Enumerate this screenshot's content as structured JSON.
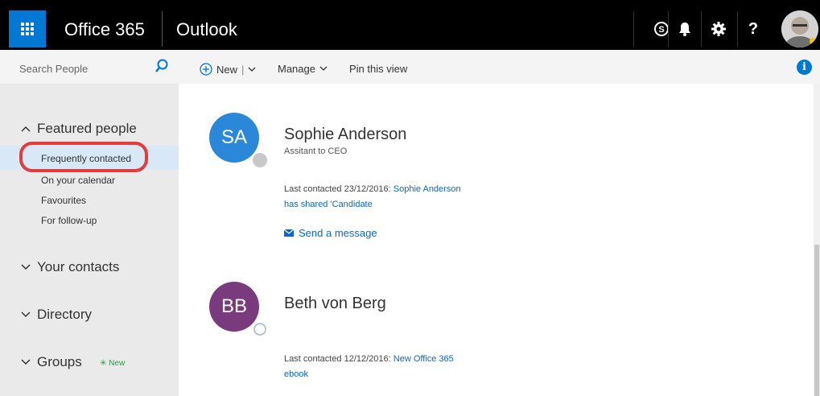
{
  "topbar": {
    "brand": "Office 365",
    "app": "Outlook",
    "icons": [
      "waffle-icon",
      "skype-icon",
      "bell-icon",
      "gear-icon",
      "help-icon"
    ],
    "help_label": "?"
  },
  "search": {
    "placeholder": "Search People"
  },
  "commandbar": {
    "new_label": "New",
    "new_sep": "|",
    "manage_label": "Manage",
    "pin_label": "Pin this view"
  },
  "nav": {
    "featured": {
      "label": "Featured people",
      "items": [
        "Frequently contacted",
        "On your calendar",
        "Favourites",
        "For follow-up"
      ]
    },
    "contacts": "Your contacts",
    "directory": "Directory",
    "groups": "Groups",
    "groups_badge": "New"
  },
  "people": [
    {
      "initials": "SA",
      "name": "Sophie Anderson",
      "title": "Assitant to CEO",
      "last_prefix": "Last contacted 23/12/2016: ",
      "last_link": "Sophie Anderson has shared 'Candidate",
      "send": "Send a message",
      "color": "#2b88d8"
    },
    {
      "initials": "BB",
      "name": "Beth von Berg",
      "last_prefix": "Last contacted 12/12/2016: ",
      "last_link": "New Office 365 ebook",
      "color": "#7a3a7e"
    }
  ],
  "colors": {
    "accent": "#0078d4",
    "highlight_ring": "#e23c3c",
    "selected_bg": "#d8e8f7"
  }
}
